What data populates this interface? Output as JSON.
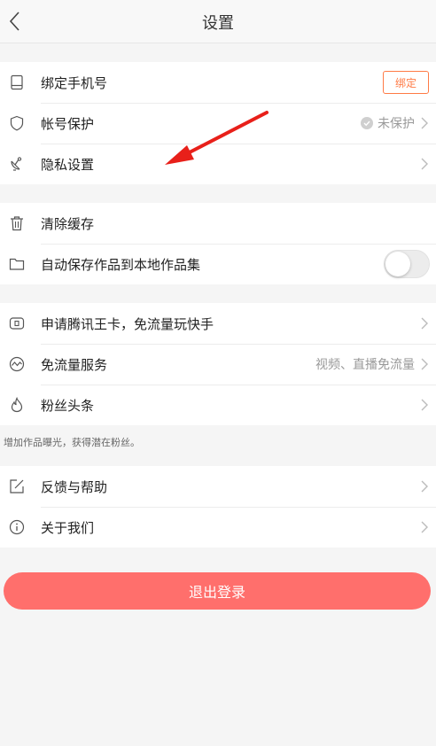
{
  "header": {
    "title": "设置"
  },
  "group1": {
    "bind_phone": {
      "label": "绑定手机号",
      "button": "绑定"
    },
    "account_protect": {
      "label": "帐号保护",
      "status": "未保护"
    },
    "privacy": {
      "label": "隐私设置"
    }
  },
  "group2": {
    "clear_cache": {
      "label": "清除缓存"
    },
    "auto_save": {
      "label": "自动保存作品到本地作品集",
      "toggle_on": false
    }
  },
  "group3": {
    "tencent_card": {
      "label": "申请腾讯王卡，免流量玩快手"
    },
    "free_data": {
      "label": "免流量服务",
      "sub": "视频、直播免流量"
    },
    "fans_headline": {
      "label": "粉丝头条"
    },
    "note": "增加作品曝光，获得潜在粉丝。"
  },
  "group4": {
    "feedback": {
      "label": "反馈与帮助"
    },
    "about": {
      "label": "关于我们"
    }
  },
  "logout": {
    "label": "退出登录"
  },
  "colors": {
    "accent": "#ff7a45",
    "logout": "#ff6f6c",
    "annotation_arrow": "#e8201a"
  }
}
